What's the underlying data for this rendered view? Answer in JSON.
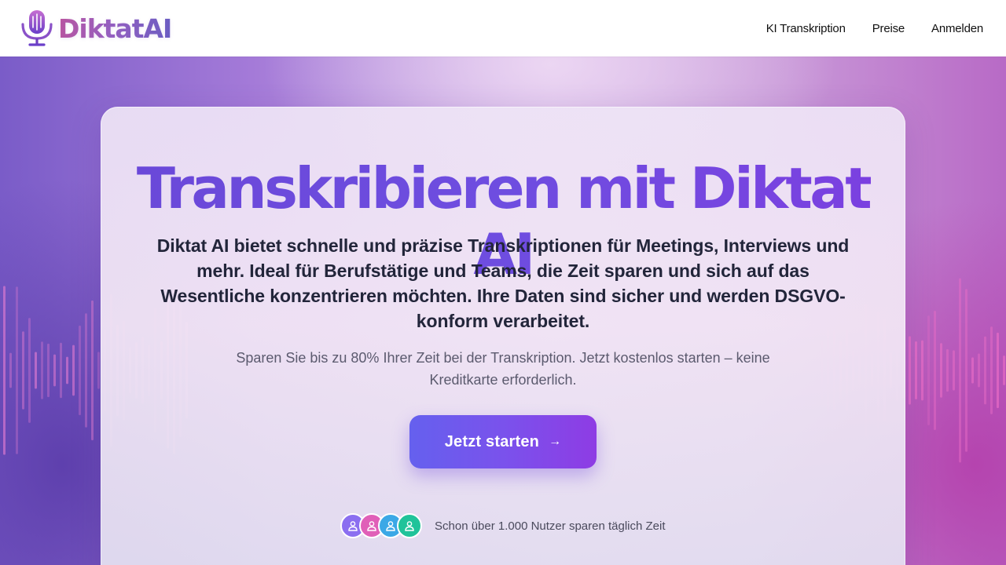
{
  "header": {
    "brand": "DiktatAI",
    "logo_icon": "microphone-icon",
    "nav": [
      {
        "label": "KI Transkription"
      },
      {
        "label": "Preise"
      },
      {
        "label": "Anmelden"
      }
    ]
  },
  "hero": {
    "title": "Transkribieren mit Diktat AI",
    "lead": "Diktat AI bietet schnelle und präzise Transkriptionen für Meetings, Interviews und mehr. Ideal für Berufstätige und Teams, die Zeit sparen und sich auf das Wesentliche konzentrieren möchten. Ihre Daten sind sicher und werden DSGVO-konform verarbeitet.",
    "subtitle": "Sparen Sie bis zu 80% Ihrer Zeit bei der Transkription. Jetzt kostenlos starten – keine Kreditkarte erforderlich.",
    "cta_label": "Jetzt starten",
    "cta_icon": "arrow-right-icon",
    "social_proof": "Schon über 1.000 Nutzer sparen täglich Zeit",
    "avatar_colors": [
      "#8b6ff0",
      "#e05fb8",
      "#3ba8e6",
      "#20c39a"
    ]
  },
  "colors": {
    "title_gradient_start": "#6a48d8",
    "title_gradient_end": "#7c3fe0",
    "cta_gradient_start": "#6560ee",
    "cta_gradient_end": "#8e3ce4",
    "lead_text": "#22253a"
  }
}
